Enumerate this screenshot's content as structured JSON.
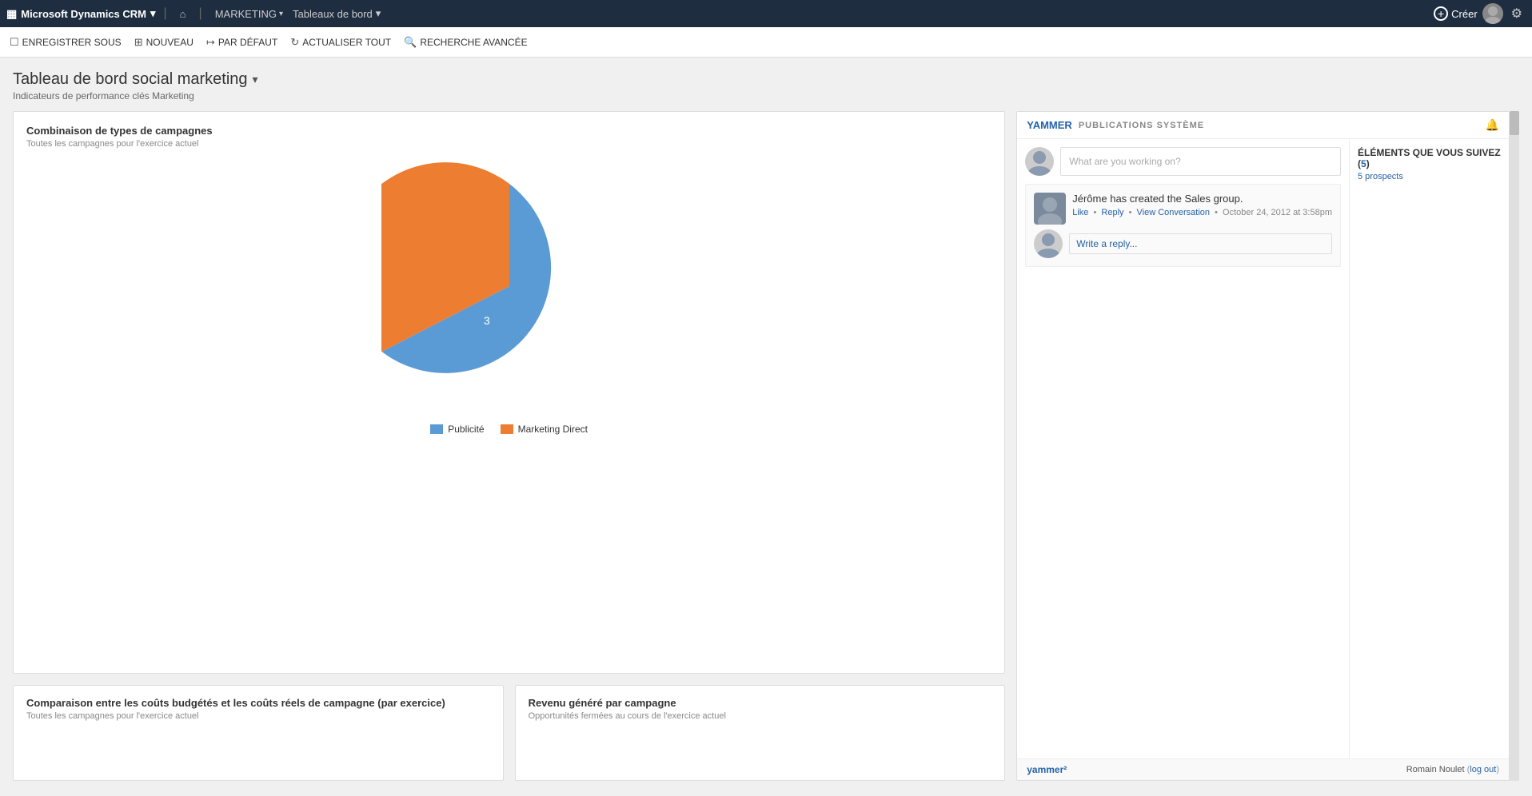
{
  "topnav": {
    "brand": "Microsoft Dynamics CRM",
    "home_icon": "⌂",
    "marketing": "MARKETING",
    "tableaux": "Tableaux de bord",
    "create": "Créer"
  },
  "toolbar": {
    "enregistrer": "ENREGISTRER SOUS",
    "nouveau": "NOUVEAU",
    "par_defaut": "PAR DÉFAUT",
    "actualiser": "ACTUALISER TOUT",
    "recherche": "RECHERCHE AVANCÉE"
  },
  "page": {
    "title": "Tableau de bord social marketing",
    "subtitle": "Indicateurs de performance clés Marketing"
  },
  "pie_chart": {
    "title": "Combinaison de types de campagnes",
    "subtitle": "Toutes les campagnes pour l'exercice actuel",
    "segments": [
      {
        "label": "Publicité",
        "value": 3,
        "color": "#5b9bd5",
        "percentage": 60
      },
      {
        "label": "Marketing Direct",
        "value": 2,
        "color": "#ed7d31",
        "percentage": 40
      }
    ]
  },
  "bottom_left": {
    "title": "Comparaison entre les coûts budgétés et les coûts réels de campagne (par exercice)",
    "subtitle": "Toutes les campagnes pour l'exercice actuel"
  },
  "bottom_right": {
    "title": "Revenu généré par campagne",
    "subtitle": "Opportunités fermées au cours de l'exercice actuel"
  },
  "yammer": {
    "brand": "YAMMER",
    "pub_sys": "PUBLICATIONS SYSTÈME",
    "post_placeholder": "What are you working on?",
    "post": {
      "username": "Jérôme",
      "action": "has created the",
      "link_text": "Sales",
      "action2": "group.",
      "like": "Like",
      "reply": "Reply",
      "view_conversation": "View Conversation",
      "timestamp": "October 24, 2012 at 3:58pm"
    },
    "reply_placeholder": "Write a reply...",
    "footer_brand": "yammer²",
    "footer_user": "Romain Noulet",
    "footer_logout": "log out",
    "sidebar_title": "ÉLÉMENTS QUE VOUS SUIVEZ (",
    "sidebar_count": "5",
    "sidebar_title_end": ")",
    "sidebar_sub": "5 prospects"
  }
}
